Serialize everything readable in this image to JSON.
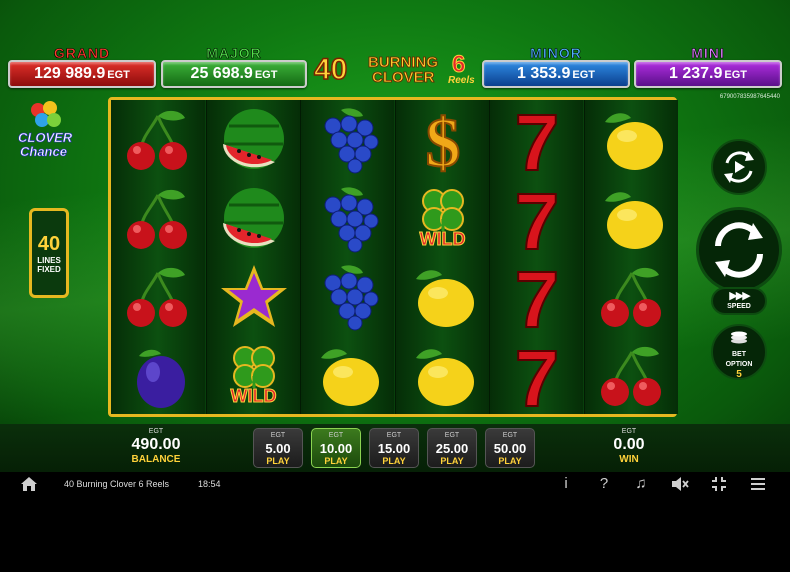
{
  "jackpots": {
    "grand": {
      "name": "GRAND",
      "value": "129 989.9",
      "unit": "EGT",
      "color": "#e0302a"
    },
    "major": {
      "name": "MAJOR",
      "value": "25 698.9",
      "unit": "EGT",
      "color": "#3db23a"
    },
    "minor": {
      "name": "MINOR",
      "value": "1 353.9",
      "unit": "EGT",
      "color": "#2f8be3"
    },
    "mini": {
      "name": "MINI",
      "value": "1 237.9",
      "unit": "EGT",
      "color": "#b02fe0"
    }
  },
  "logo": {
    "number": "40",
    "line1": "BURNING",
    "line2": "CLOVER",
    "badge": "6",
    "badge_sub": "Reels"
  },
  "serial": "679007835987645440",
  "clover_chance": {
    "line1": "CLOVER",
    "line2": "Chance"
  },
  "lines": {
    "count": "40",
    "line1": "LINES",
    "line2": "FIXED"
  },
  "reels": [
    [
      "cherry",
      "cherry",
      "cherry",
      "plum"
    ],
    [
      "watermelon",
      "watermelon",
      "star",
      "clover-wild"
    ],
    [
      "grapes",
      "grapes",
      "grapes",
      "lemon"
    ],
    [
      "dollar",
      "clover-wild",
      "lemon",
      "lemon"
    ],
    [
      "seven",
      "seven",
      "seven",
      "seven"
    ],
    [
      "lemon",
      "lemon",
      "cherry",
      "cherry"
    ]
  ],
  "wild_label": "WILD",
  "controls": {
    "speed_label": "SPEED",
    "bet_option_line1": "BET",
    "bet_option_line2": "OPTION",
    "bet_option_value": "5"
  },
  "balance": {
    "currency": "EGT",
    "value": "490.00",
    "label": "BALANCE"
  },
  "win": {
    "currency": "EGT",
    "value": "0.00",
    "label": "WIN"
  },
  "bets": [
    {
      "currency": "EGT",
      "value": "5.00",
      "label": "PLAY",
      "active": false
    },
    {
      "currency": "EGT",
      "value": "10.00",
      "label": "PLAY",
      "active": true
    },
    {
      "currency": "EGT",
      "value": "15.00",
      "label": "PLAY",
      "active": false
    },
    {
      "currency": "EGT",
      "value": "25.00",
      "label": "PLAY",
      "active": false
    },
    {
      "currency": "EGT",
      "value": "50.00",
      "label": "PLAY",
      "active": false
    }
  ],
  "footer": {
    "game_title": "40 Burning Clover 6 Reels",
    "time": "18:54",
    "icons": [
      "info-icon",
      "help-icon",
      "music-off-icon",
      "sound-off-icon",
      "fullscreen-icon",
      "menu-icon"
    ]
  }
}
